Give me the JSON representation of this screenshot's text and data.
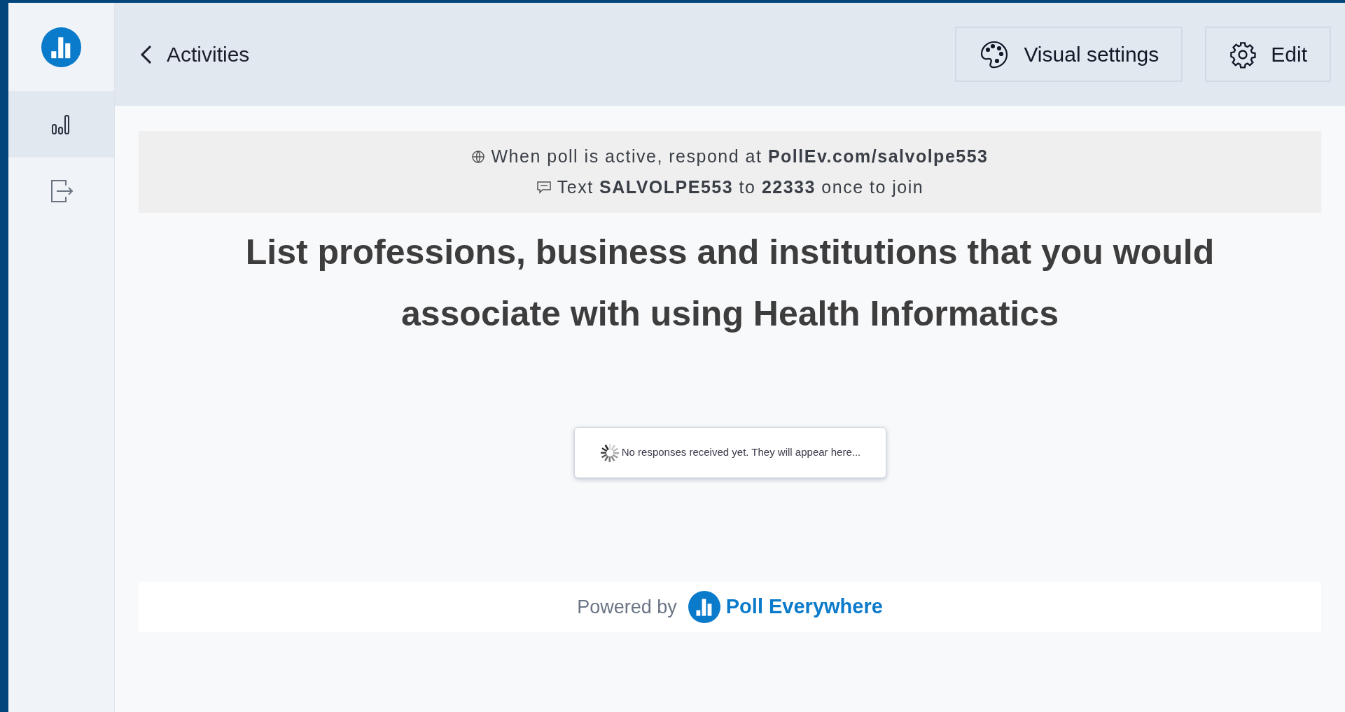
{
  "sidebar": {
    "items": [
      {
        "kind": "results",
        "selected": true
      },
      {
        "kind": "exit",
        "selected": false
      }
    ]
  },
  "header": {
    "back_label": "Activities",
    "buttons": [
      {
        "kind": "palette",
        "label": "Visual settings"
      },
      {
        "kind": "gear",
        "label": "Edit"
      }
    ]
  },
  "banner": {
    "web_line": "When poll is active, respond at **PollEv.com/salvolpe553**",
    "text_line": "Text **SALVOLPE553** to **22333** once to join"
  },
  "question": "List professions, business and institutions that you would associate with using Health Informatics",
  "status_message": "No responses received yet. They will appear here...",
  "footer": {
    "powered_by": "Powered by",
    "brand": "Poll Everywhere"
  }
}
